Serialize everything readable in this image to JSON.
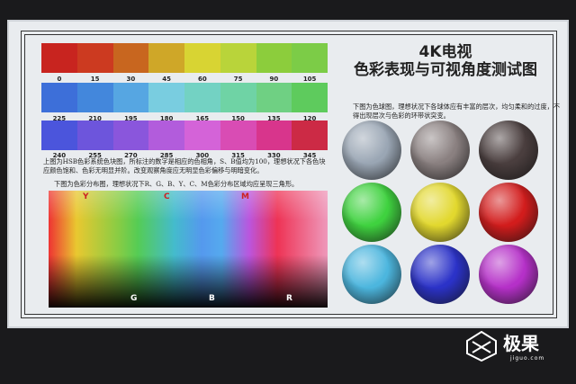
{
  "title": {
    "line1": "4K电视",
    "line2": "色彩表现与可视角度测试图"
  },
  "rows": [
    {
      "hues": [
        "0",
        "15",
        "30",
        "45",
        "60",
        "75",
        "90",
        "105"
      ],
      "colors": [
        "#c8241f",
        "#cc3a20",
        "#c8661f",
        "#cfa728",
        "#d8d433",
        "#b9d43a",
        "#8ccd3c",
        "#7ccc47"
      ]
    },
    {
      "hues": [
        "225",
        "210",
        "195",
        "180",
        "165",
        "150",
        "135",
        "120"
      ],
      "colors": [
        "#3d6fd9",
        "#4387dc",
        "#56a6e2",
        "#79cde0",
        "#73d2c3",
        "#6fd3a5",
        "#6fd083",
        "#5ecb5d"
      ]
    },
    {
      "hues": [
        "240",
        "255",
        "270",
        "285",
        "300",
        "315",
        "330",
        "345"
      ],
      "colors": [
        "#4b55dc",
        "#6d55dc",
        "#8a56dc",
        "#b25cdc",
        "#d463d8",
        "#d94cb4",
        "#d8358c",
        "#cc2a45"
      ]
    }
  ],
  "text1": "上图为HSB色彩系统色块图，所标注的数字是相应的色相角，S、B值均为100，理想状况下各色块应颜色饱和、色彩无明显并阶。改变观察角度应无明显色彩偏移与明暗变化。",
  "text2": "下图为色彩分布图，理想状况下R、G、B、Y、C、M色彩分布区域均应呈现三角形。",
  "gradient_labels": {
    "top": [
      "Y",
      "C",
      "M"
    ],
    "bottom": [
      "G",
      "B",
      "R"
    ]
  },
  "text3": "下图为色球图，理想状况下各球体应有丰富的层次，均匀柔和的过度，不得出现层次与色彩的环带状突变。",
  "spheres": [
    "#9aa6b4",
    "#8a8080",
    "#4a3e3e",
    "#3fd23f",
    "#e2d82e",
    "#d21c1c",
    "#4cb6de",
    "#2b32c8",
    "#b530c8"
  ],
  "logo": {
    "name": "极果",
    "url": "jiguo.com"
  }
}
